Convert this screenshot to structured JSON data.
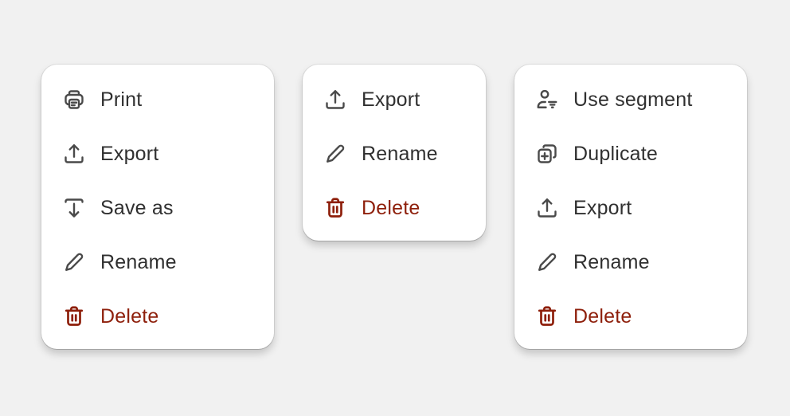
{
  "colors": {
    "background": "#f1f1f1",
    "text": "#303030",
    "icon": "#4a4a4a",
    "critical": "#8e1f0b"
  },
  "menus": [
    {
      "name": "menu-1",
      "items": [
        {
          "label": "Print",
          "icon": "print-icon"
        },
        {
          "label": "Export",
          "icon": "export-icon"
        },
        {
          "label": "Save as",
          "icon": "save-as-icon"
        },
        {
          "label": "Rename",
          "icon": "edit-icon"
        },
        {
          "label": "Delete",
          "icon": "delete-icon",
          "tone": "critical"
        }
      ]
    },
    {
      "name": "menu-2",
      "items": [
        {
          "label": "Export",
          "icon": "export-icon"
        },
        {
          "label": "Rename",
          "icon": "edit-icon"
        },
        {
          "label": "Delete",
          "icon": "delete-icon",
          "tone": "critical"
        }
      ]
    },
    {
      "name": "menu-3",
      "items": [
        {
          "label": "Use segment",
          "icon": "person-filter-icon"
        },
        {
          "label": "Duplicate",
          "icon": "duplicate-icon"
        },
        {
          "label": "Export",
          "icon": "export-icon"
        },
        {
          "label": "Rename",
          "icon": "edit-icon"
        },
        {
          "label": "Delete",
          "icon": "delete-icon",
          "tone": "critical"
        }
      ]
    }
  ]
}
